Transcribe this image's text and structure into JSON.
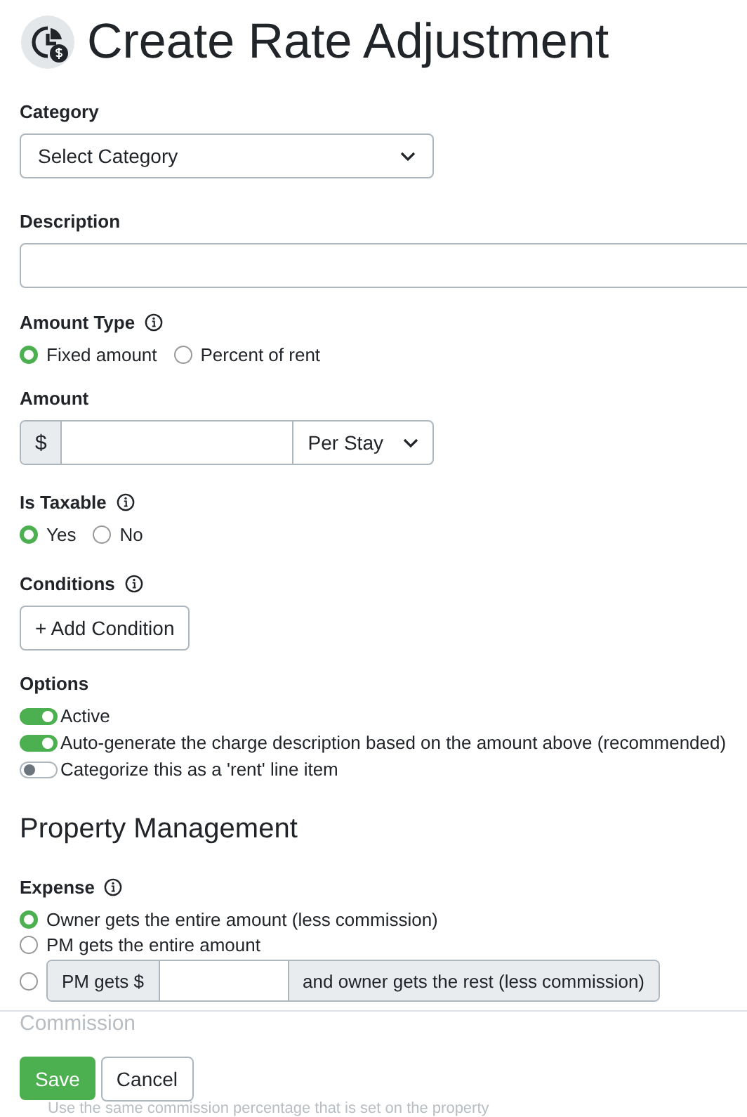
{
  "title": "Create Rate Adjustment",
  "category": {
    "label": "Category",
    "value": "Select Category"
  },
  "description": {
    "label": "Description"
  },
  "amount_type": {
    "label": "Amount Type",
    "options": [
      {
        "label": "Fixed amount",
        "selected": true
      },
      {
        "label": "Percent of rent",
        "selected": false
      }
    ]
  },
  "amount": {
    "label": "Amount",
    "prefix": "$",
    "period": "Per Stay"
  },
  "is_taxable": {
    "label": "Is Taxable",
    "options": [
      {
        "label": "Yes",
        "selected": true
      },
      {
        "label": "No",
        "selected": false
      }
    ]
  },
  "conditions": {
    "label": "Conditions",
    "button": "+ Add Condition"
  },
  "options": {
    "label": "Options",
    "toggles": [
      {
        "label": "Active",
        "on": true
      },
      {
        "label": "Auto-generate the charge description based on the amount above (recommended)",
        "on": true
      },
      {
        "label": "Categorize this as a 'rent' line item",
        "on": false
      }
    ]
  },
  "property_management": {
    "heading": "Property Management",
    "expense": {
      "label": "Expense",
      "options": [
        {
          "kind": "plain",
          "label": "Owner gets the entire amount (less commission)",
          "selected": true
        },
        {
          "kind": "plain",
          "label": "PM gets the entire amount",
          "selected": false
        },
        {
          "kind": "split",
          "prefix": "PM gets $",
          "suffix": "and owner gets the rest (less commission)",
          "selected": false
        }
      ]
    }
  },
  "commission": {
    "label": "Commission",
    "note": "Use the same commission percentage that is set on the property"
  },
  "buttons": {
    "save": "Save",
    "cancel": "Cancel"
  }
}
